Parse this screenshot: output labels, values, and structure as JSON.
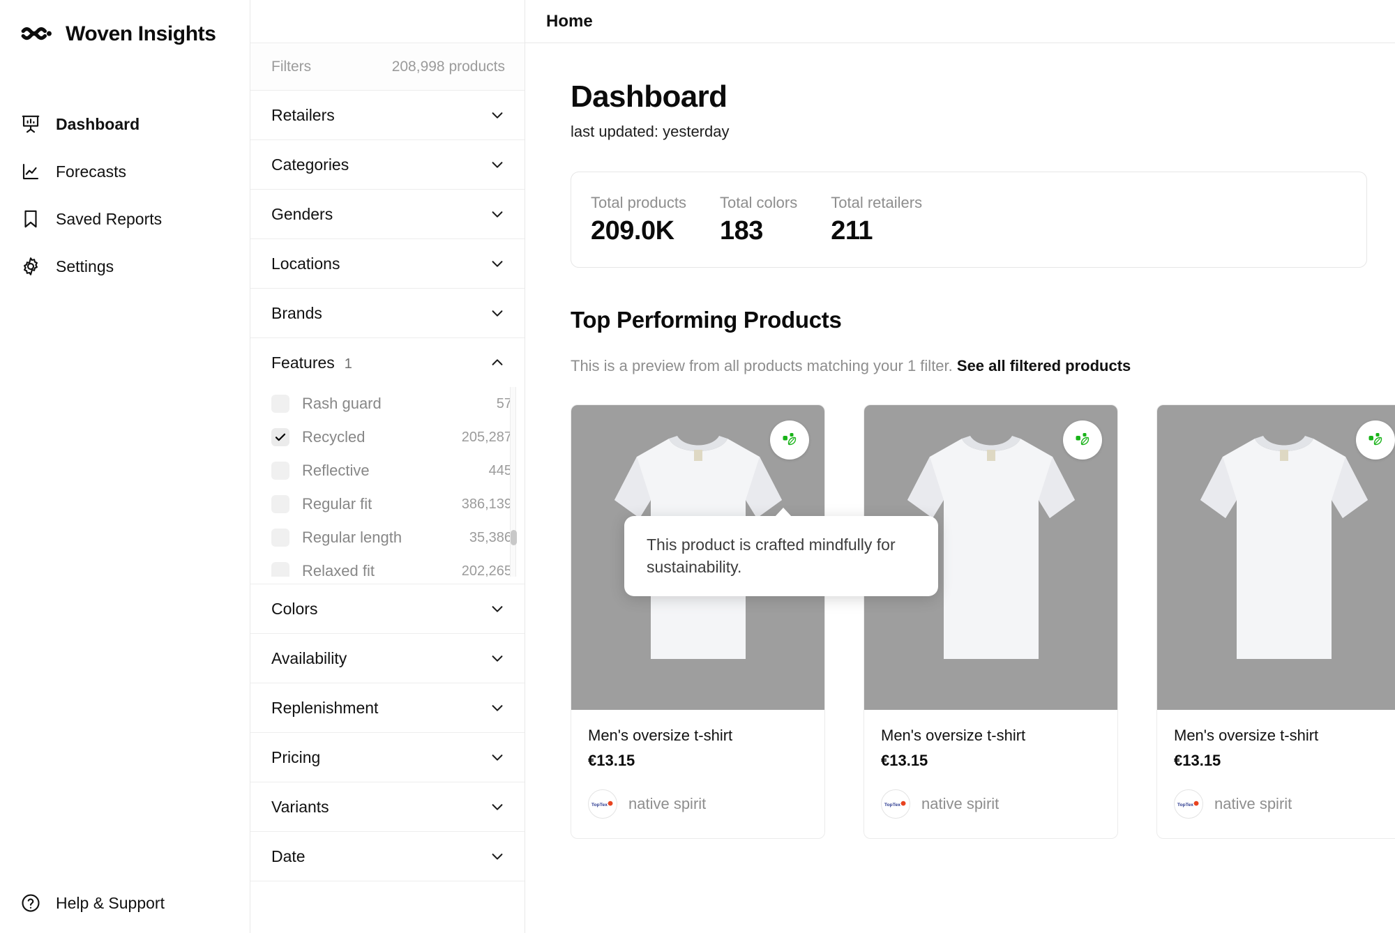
{
  "brand": {
    "name": "Woven Insights",
    "logo_icon": "woven-logo-icon"
  },
  "sidebar": {
    "items": [
      {
        "label": "Dashboard",
        "icon": "presentation-chart-icon",
        "active": true
      },
      {
        "label": "Forecasts",
        "icon": "line-chart-icon",
        "active": false
      },
      {
        "label": "Saved Reports",
        "icon": "bookmark-icon",
        "active": false
      },
      {
        "label": "Settings",
        "icon": "gear-icon",
        "active": false
      }
    ],
    "bottom": {
      "label": "Help & Support",
      "icon": "question-circle-icon"
    }
  },
  "filters": {
    "header_label": "Filters",
    "product_count": "208,998 products",
    "sections": [
      {
        "label": "Retailers",
        "expanded": false
      },
      {
        "label": "Categories",
        "expanded": false
      },
      {
        "label": "Genders",
        "expanded": false
      },
      {
        "label": "Locations",
        "expanded": false
      },
      {
        "label": "Brands",
        "expanded": false
      },
      {
        "label": "Features",
        "badge": "1",
        "expanded": true
      },
      {
        "label": "Colors",
        "expanded": false
      },
      {
        "label": "Availability",
        "expanded": false
      },
      {
        "label": "Replenishment",
        "expanded": false
      },
      {
        "label": "Pricing",
        "expanded": false
      },
      {
        "label": "Variants",
        "expanded": false
      },
      {
        "label": "Date",
        "expanded": false
      }
    ],
    "features": [
      {
        "label": "Rash guard",
        "count": "57",
        "checked": false
      },
      {
        "label": "Recycled",
        "count": "205,287",
        "checked": true
      },
      {
        "label": "Reflective",
        "count": "445",
        "checked": false
      },
      {
        "label": "Regular fit",
        "count": "386,139",
        "checked": false
      },
      {
        "label": "Regular length",
        "count": "35,386",
        "checked": false
      },
      {
        "label": "Relaxed fit",
        "count": "202,265",
        "checked": false
      }
    ]
  },
  "topbar": {
    "tab_home": "Home"
  },
  "page": {
    "title": "Dashboard",
    "subtitle": "last updated: yesterday"
  },
  "stats": [
    {
      "label": "Total products",
      "value": "209.0K"
    },
    {
      "label": "Total colors",
      "value": "183"
    },
    {
      "label": "Total retailers",
      "value": "211"
    }
  ],
  "top_products": {
    "heading": "Top Performing Products",
    "description": "This is a preview from all products matching your 1 filter.",
    "link_label": "See all filtered products",
    "cards": [
      {
        "name": "Men's oversize t-shirt",
        "price": "€13.15",
        "brand": "native spirit",
        "brand_logo": "toptex-logo-icon",
        "eco_badge": "leaf-sustainability-icon"
      },
      {
        "name": "Men's oversize t-shirt",
        "price": "€13.15",
        "brand": "native spirit",
        "brand_logo": "toptex-logo-icon",
        "eco_badge": "leaf-sustainability-icon"
      },
      {
        "name": "Men's oversize t-shirt",
        "price": "€13.15",
        "brand": "native spirit",
        "brand_logo": "toptex-logo-icon",
        "eco_badge": "leaf-sustainability-icon"
      }
    ]
  },
  "tooltip": {
    "text": "This product is crafted mindfully for sustainability."
  },
  "colors": {
    "eco_green": "#18b318",
    "image_bg": "#9e9e9e",
    "muted": "#8e8e8e"
  }
}
